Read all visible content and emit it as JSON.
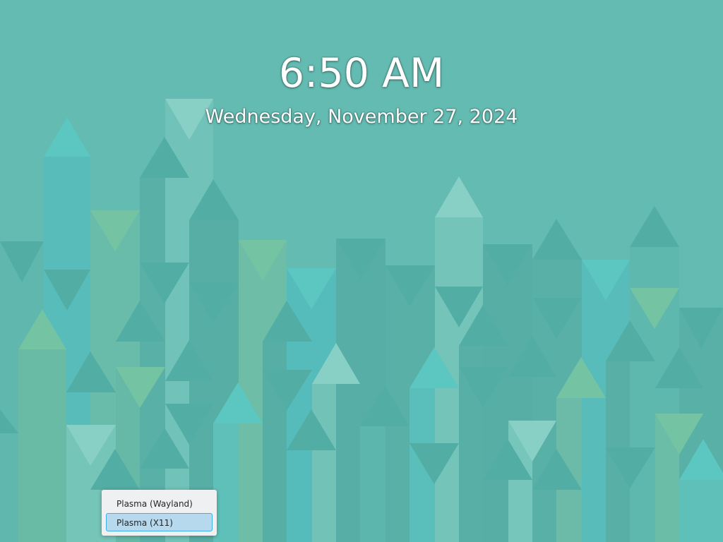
{
  "lockscreen": {
    "time": "6:50 AM",
    "date": "Wednesday, November 27, 2024"
  },
  "session_menu": {
    "items": [
      {
        "label": "Plasma (Wayland)",
        "selected": false
      },
      {
        "label": "Plasma (X11)",
        "selected": true
      }
    ]
  },
  "colors": {
    "background": "#63bbb1",
    "selection": "#b6d9ee",
    "selection_border": "#3daee9"
  }
}
